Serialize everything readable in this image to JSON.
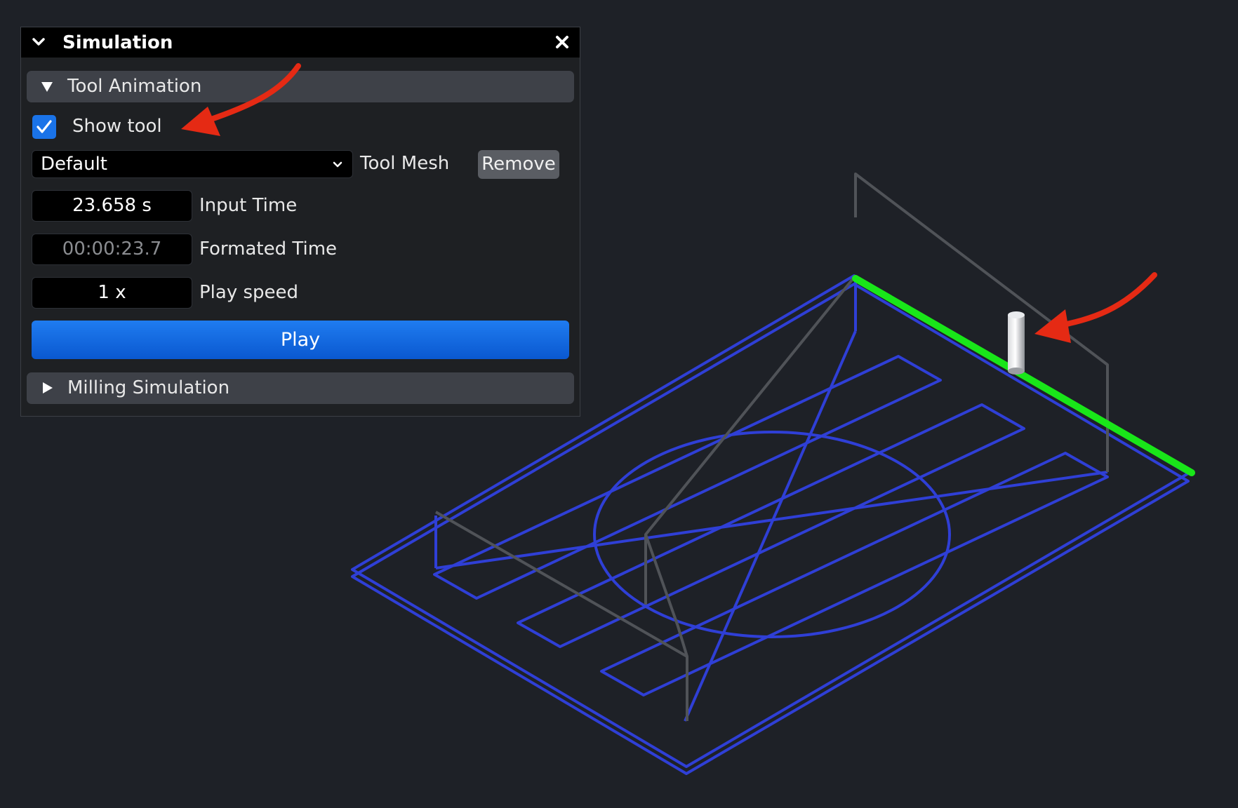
{
  "panel": {
    "title": "Simulation",
    "tool_animation": {
      "header": "Tool Animation",
      "show_tool_label": "Show tool",
      "show_tool_checked": true,
      "tool_mesh_value": "Default",
      "tool_mesh_label": "Tool Mesh",
      "remove_label": "Remove",
      "input_time_value": "23.658 s",
      "input_time_label": "Input Time",
      "formatted_time_value": "00:00:23.7",
      "formatted_time_label": "Formated Time",
      "play_speed_value": "1 x",
      "play_speed_label": "Play speed",
      "play_label": "Play"
    },
    "milling_simulation": {
      "header": "Milling Simulation"
    }
  },
  "colors": {
    "background": "#1e2127",
    "toolpath": "#2f3fd6",
    "rapid_move": "#505358",
    "current_segment": "#19e619",
    "annotation_arrow": "#e52a14",
    "accent": "#1a73e8"
  },
  "icons": {
    "title_collapse": "chevron-down-icon",
    "close": "close-icon",
    "section_expanded": "triangle-down-icon",
    "section_collapsed": "triangle-right-icon",
    "checkbox": "checkmark-icon",
    "combo": "chevron-down-icon"
  }
}
